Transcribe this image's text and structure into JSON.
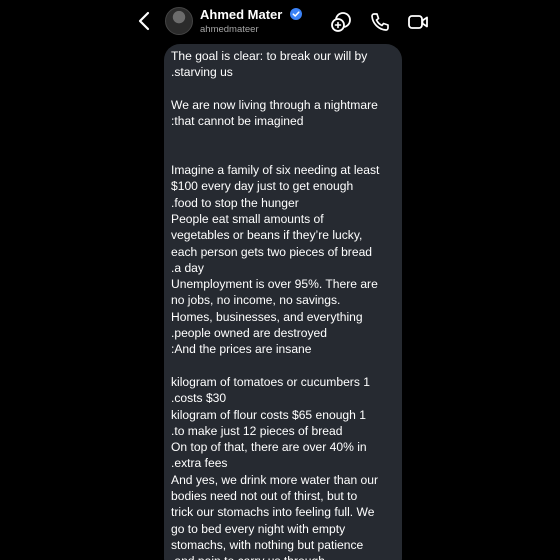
{
  "header": {
    "back_icon": "chevron-left-icon",
    "display_name": "Ahmed Mater",
    "username": "ahmedmateer",
    "verified": true,
    "actions": [
      {
        "name": "video-call-group-icon"
      },
      {
        "name": "phone-icon"
      },
      {
        "name": "video-camera-icon"
      }
    ]
  },
  "message": {
    "lines": [
      "The goal is clear: to break our will by",
      ".starving us",
      "",
      "We are now living through a nightmare",
      ":that cannot be imagined",
      "",
      "",
      "Imagine a family of six needing at least",
      "$100 every day just to get enough",
      ".food to stop the hunger",
      "People eat small amounts of",
      "vegetables or beans if they’re lucky,",
      "each person gets two pieces of bread",
      ".a day",
      "Unemployment is over 95%. There are",
      "no jobs, no income, no savings.",
      "Homes, businesses, and everything",
      ".people owned are destroyed",
      ":And the prices are insane",
      "",
      "kilogram of tomatoes or cucumbers 1",
      ".costs $30",
      "kilogram of flour costs $65 enough 1",
      ".to make just 12 pieces of bread",
      "On top of that, there are over 40% in",
      ".extra fees",
      "And yes, we drink more water than our",
      "bodies need not out of thirst, but to",
      "trick our stomachs into feeling full. We",
      "go to bed every night with empty",
      "stomachs, with nothing but patience",
      ".and pain to carry us through"
    ]
  },
  "colors": {
    "background": "#000000",
    "bubble": "#262a31",
    "verified_badge": "#3b82f6",
    "text": "#ffffff",
    "secondary_text": "#a7a7a7"
  }
}
